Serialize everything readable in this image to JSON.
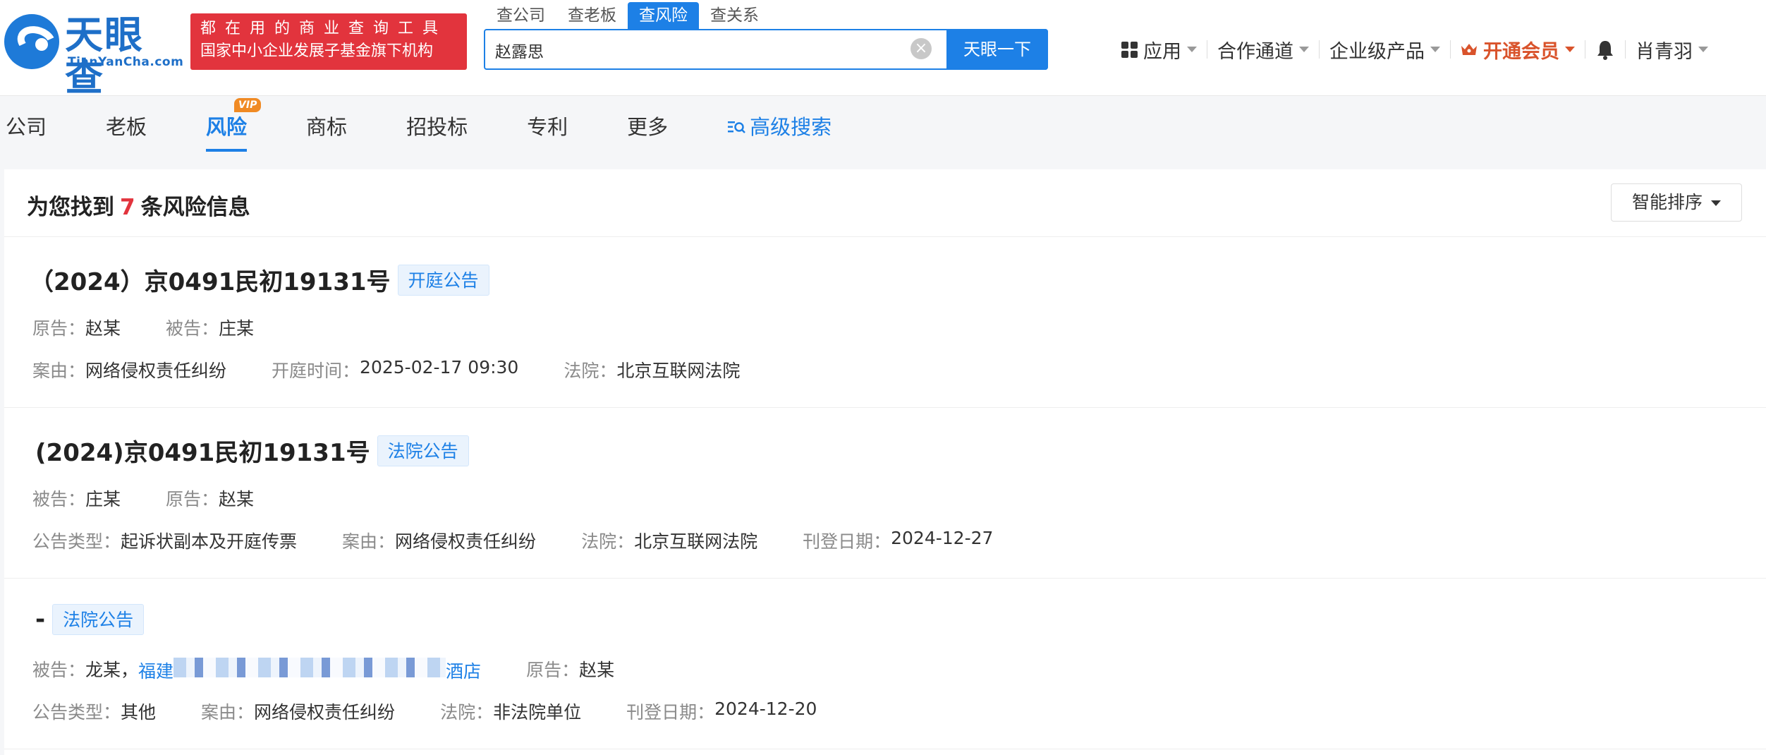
{
  "logo": {
    "cn": "天眼查",
    "en": "TianYanCha.com"
  },
  "slogan": {
    "line1": "都在用的商业查询工具",
    "line2": "国家中小企业发展子基金旗下机构"
  },
  "search_tabs": [
    "查公司",
    "查老板",
    "查风险",
    "查关系"
  ],
  "search": {
    "value": "赵露思",
    "button": "天眼一下"
  },
  "top_nav": {
    "apps": "应用",
    "channel": "合作通道",
    "enterprise": "企业级产品",
    "vip": "开通会员",
    "user": "肖青羽"
  },
  "category_tabs": [
    "公司",
    "老板",
    "风险",
    "商标",
    "招投标",
    "专利",
    "更多"
  ],
  "vip_badge": "VIP",
  "advanced_search": "高级搜索",
  "result": {
    "prefix": "为您找到",
    "count": "7",
    "suffix": "条风险信息",
    "sort_label": "智能排序"
  },
  "cards": [
    {
      "title": "（2024）京0491民初19131号",
      "tag": "开庭公告",
      "row1": [
        {
          "label": "原告：",
          "value": "赵某"
        },
        {
          "label": "被告：",
          "value": "庄某"
        }
      ],
      "row2": [
        {
          "label": "案由：",
          "value": "网络侵权责任纠纷"
        },
        {
          "label": "开庭时间：",
          "value": "2025-02-17 09:30"
        },
        {
          "label": "法院：",
          "value": "北京互联网法院"
        }
      ]
    },
    {
      "title": "(2024)京0491民初19131号",
      "tag": "法院公告",
      "row1": [
        {
          "label": "被告：",
          "value": "庄某"
        },
        {
          "label": "原告：",
          "value": "赵某"
        }
      ],
      "row2": [
        {
          "label": "公告类型：",
          "value": "起诉状副本及开庭传票"
        },
        {
          "label": "案由：",
          "value": "网络侵权责任纠纷"
        },
        {
          "label": "法院：",
          "value": "北京互联网法院"
        },
        {
          "label": "刊登日期：",
          "value": "2024-12-27"
        }
      ]
    },
    {
      "title": "-",
      "tag": "法院公告",
      "row1": {
        "defendant_label": "被告：",
        "defendant_person": "龙某，",
        "defendant_link_start": "福建",
        "defendant_link_end": "酒店",
        "plaintiff_label": "原告：",
        "plaintiff_value": "赵某"
      },
      "row2": [
        {
          "label": "公告类型：",
          "value": "其他"
        },
        {
          "label": "案由：",
          "value": "网络侵权责任纠纷"
        },
        {
          "label": "法院：",
          "value": "非法院单位"
        },
        {
          "label": "刊登日期：",
          "value": "2024-12-20"
        }
      ]
    }
  ]
}
